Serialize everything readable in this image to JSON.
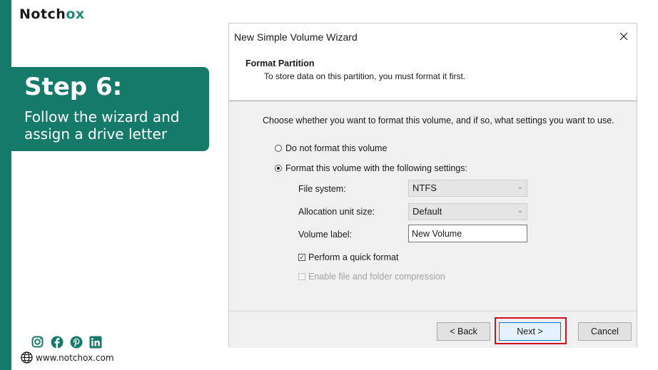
{
  "brand": {
    "logo_main": "Notch",
    "logo_accent": "ox",
    "website": "www.notchox.com"
  },
  "step": {
    "title": "Step 6:",
    "description": "Follow the wizard and assign a drive letter"
  },
  "social_icons": [
    "instagram-icon",
    "facebook-icon",
    "pinterest-icon",
    "linkedin-icon"
  ],
  "wizard": {
    "title": "New Simple Volume Wizard",
    "header_title": "Format Partition",
    "header_subtitle": "To store data on this partition, you must format it first.",
    "instruction": "Choose whether you want to format this volume, and if so, what settings you want to use.",
    "options": {
      "no_format": {
        "label": "Do not format this volume",
        "selected": false
      },
      "format": {
        "label": "Format this volume with the following settings:",
        "selected": true
      }
    },
    "fields": {
      "file_system": {
        "label": "File system:",
        "value": "NTFS"
      },
      "allocation": {
        "label": "Allocation unit size:",
        "value": "Default"
      },
      "volume_label": {
        "label": "Volume label:",
        "value": "New Volume"
      }
    },
    "checks": {
      "quick_format": {
        "label": "Perform a quick format",
        "checked": true,
        "mark": "✓"
      },
      "compression": {
        "label": "Enable file and folder compression",
        "checked": false,
        "enabled": false
      }
    },
    "buttons": {
      "back": "< Back",
      "next": "Next >",
      "cancel": "Cancel"
    }
  },
  "colors": {
    "brand_teal": "#167a6b",
    "highlight_red": "#d10f1b"
  }
}
